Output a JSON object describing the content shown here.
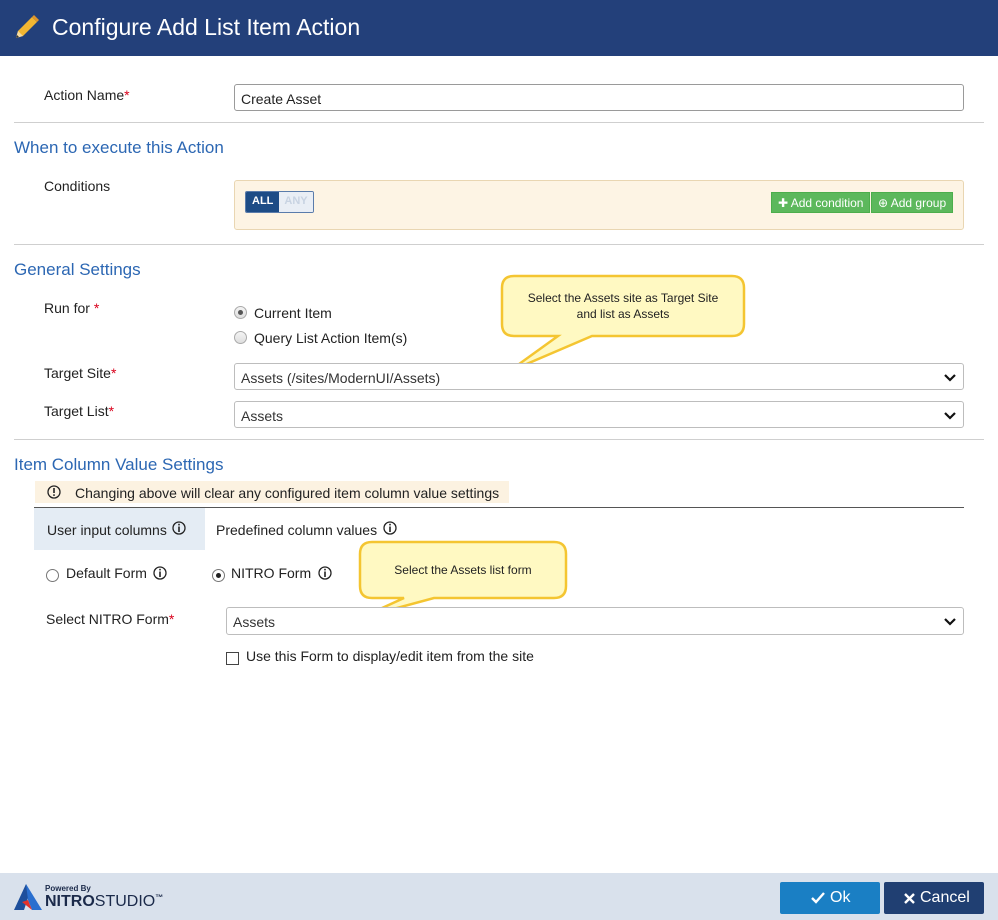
{
  "dialog": {
    "title": "Configure Add List Item Action"
  },
  "action_name": {
    "label": "Action Name",
    "required": "*",
    "value": "Create Asset"
  },
  "when_section": {
    "heading": "When to execute this Action",
    "conditions_label": "Conditions",
    "toggle_all": "ALL",
    "toggle_any": "ANY",
    "add_condition": "Add condition",
    "add_group": "Add group"
  },
  "general_section": {
    "heading": "General Settings",
    "run_for_label": "Run for",
    "required": "*",
    "run_for_options": [
      "Current Item",
      "Query List Action Item(s)"
    ],
    "run_for_selected": "Current Item",
    "target_site_label": "Target Site",
    "target_site_value": "Assets (/sites/ModernUI/Assets)",
    "target_list_label": "Target List",
    "target_list_value": "Assets",
    "callout": "Select the Assets site as Target Site and list as Assets"
  },
  "item_section": {
    "heading": "Item Column Value Settings",
    "warning": "Changing above will clear any configured item column value settings",
    "tabs": [
      "User input columns",
      "Predefined column values"
    ],
    "active_tab": "User input columns",
    "form_options": [
      "Default Form",
      "NITRO Form"
    ],
    "form_selected": "NITRO Form",
    "select_form_label": "Select NITRO Form",
    "required": "*",
    "select_form_value": "Assets",
    "checkbox_label": "Use this Form to display/edit item from the site",
    "checkbox_checked": false,
    "callout": "Select the Assets list form"
  },
  "footer": {
    "powered_by": "Powered By",
    "brand_nitro": "NITRO",
    "brand_studio": "STUDIO",
    "trademark": "™",
    "ok": "Ok",
    "cancel": "Cancel"
  },
  "colors": {
    "header": "#23407a",
    "section_heading": "#2c67b3",
    "ok_button": "#1a7fc4",
    "cancel_button": "#203f72",
    "add_button": "#5cb85c"
  }
}
